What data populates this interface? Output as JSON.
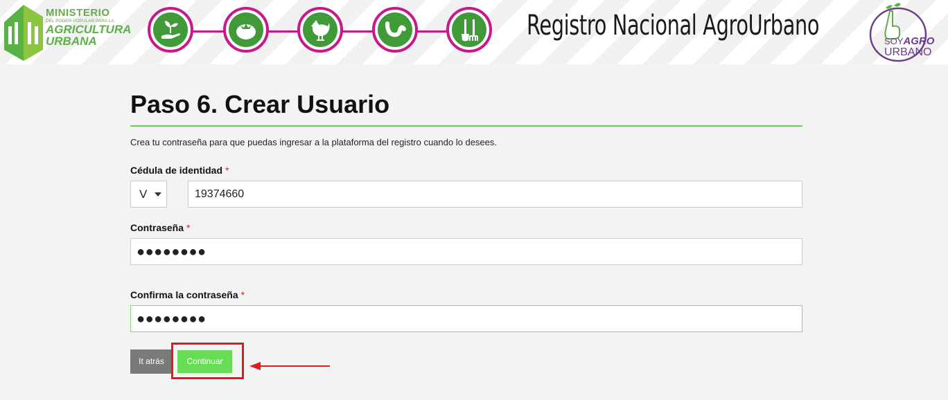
{
  "header": {
    "ministry_logo": {
      "line1": "MINISTERIO",
      "line2": "DEL PODER POPULAR PARA LA",
      "line3": "AGRICULTURA",
      "line4": "URBANA"
    },
    "step_icons": [
      "hand-plant-icon",
      "tomato-icon",
      "chicken-icon",
      "worm-icon",
      "garden-tools-icon"
    ],
    "title": "Registro Nacional AgroUrbano",
    "soy_logo": {
      "soy": "SOY",
      "agro": "AGRO",
      "urbano": "URBANO"
    }
  },
  "form": {
    "title": "Paso 6. Crear Usuario",
    "intro": "Crea tu contraseña para que puedas ingresar a la plataforma del registro cuando lo desees.",
    "required_mark": "*",
    "cedula": {
      "label": "Cédula de identidad",
      "type_value": "V",
      "number_value": "19374660"
    },
    "password": {
      "label": "Contraseña",
      "masked_value": "●●●●●●●●"
    },
    "confirm_password": {
      "label": "Confirma la contraseña",
      "masked_value": "●●●●●●●●"
    },
    "back_button": "It atrás",
    "continue_button": "Continuar"
  },
  "annotation": {
    "highlight_color": "#e01b1b",
    "arrow_icon": "left-arrow-icon"
  },
  "colors": {
    "accent_green": "#66dd55",
    "chain_magenta": "#c8188a",
    "icon_green": "#3f9a37",
    "required_red": "#d9231d"
  }
}
